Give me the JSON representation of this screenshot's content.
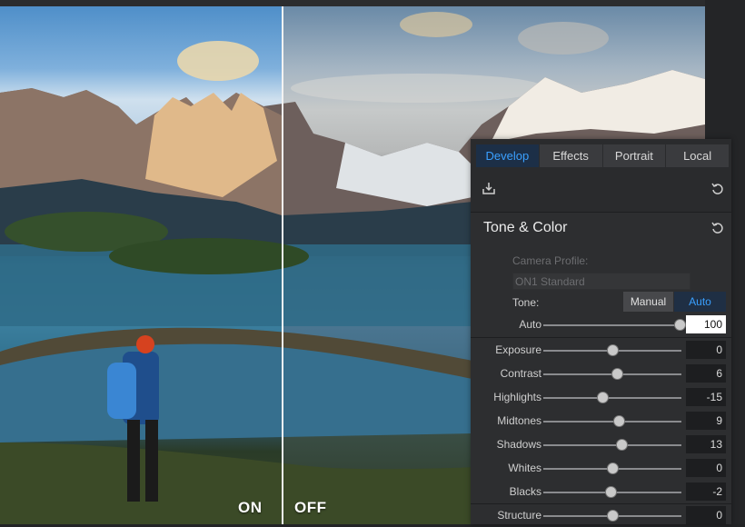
{
  "comparison": {
    "on_label": "ON",
    "off_label": "OFF"
  },
  "panel": {
    "tabs": [
      {
        "label": "Develop",
        "active": true
      },
      {
        "label": "Effects",
        "active": false
      },
      {
        "label": "Portrait",
        "active": false
      },
      {
        "label": "Local",
        "active": false
      }
    ],
    "save_icon": "download-icon",
    "reset_icon": "reset-icon",
    "section_title": "Tone & Color",
    "camera_profile_label": "Camera Profile:",
    "camera_profile_value": "ON1 Standard",
    "tone_label": "Tone:",
    "tone_manual": "Manual",
    "tone_auto": "Auto",
    "sliders": [
      {
        "label": "Auto",
        "value": "100",
        "min": 0,
        "max": 100
      },
      {
        "label": "Exposure",
        "value": "0",
        "min": -100,
        "max": 100
      },
      {
        "label": "Contrast",
        "value": "6",
        "min": -100,
        "max": 100
      },
      {
        "label": "Highlights",
        "value": "-15",
        "min": -100,
        "max": 100
      },
      {
        "label": "Midtones",
        "value": "9",
        "min": -100,
        "max": 100
      },
      {
        "label": "Shadows",
        "value": "13",
        "min": -100,
        "max": 100
      },
      {
        "label": "Whites",
        "value": "0",
        "min": -100,
        "max": 100
      },
      {
        "label": "Blacks",
        "value": "-2",
        "min": -100,
        "max": 100
      },
      {
        "label": "Structure",
        "value": "0",
        "min": -100,
        "max": 100
      }
    ]
  },
  "colors": {
    "accent": "#3aa0ff",
    "active_tab_bg": "#1c2f47",
    "panel_bg": "#2a2b2d"
  }
}
